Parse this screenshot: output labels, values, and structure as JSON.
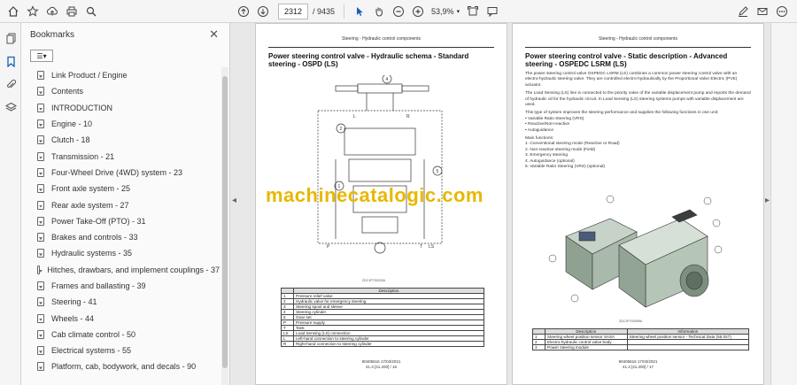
{
  "toolbar": {
    "page_current": "2312",
    "page_total": "/ 9435",
    "zoom": "53,9%",
    "icons": [
      "home-icon",
      "star-icon",
      "upload-icon",
      "print-icon",
      "zoom-search-icon",
      "arrow-up-icon",
      "arrow-down-icon",
      "select-cursor-icon",
      "hand-icon",
      "zoom-out-icon",
      "zoom-in-icon",
      "fit-page-icon",
      "comment-icon",
      "sign-pen-icon",
      "mail-icon",
      "more-icon"
    ]
  },
  "panel": {
    "title": "Bookmarks",
    "bookmarks": [
      "Link Product / Engine",
      "Contents",
      "INTRODUCTION",
      "Engine - 10",
      "Clutch - 18",
      "Transmission - 21",
      "Four-Wheel Drive (4WD) system - 23",
      "Front axle system - 25",
      "Rear axle system - 27",
      "Power Take-Off (PTO) - 31",
      "Brakes and controls - 33",
      "Hydraulic systems - 35",
      "Hitches, drawbars, and implement couplings - 37",
      "Frames and ballasting - 39",
      "Steering - 41",
      "Wheels - 44",
      "Cab climate control - 50",
      "Electrical systems - 55",
      "Platform, cab, bodywork, and decals - 90"
    ]
  },
  "left_page": {
    "header": "Steering - Hydraulic control components",
    "title": "Power steering control valve - Hydraulic schema - Standard steering - OSPD (LS)",
    "figure_id": "ZDC1PTS0033A",
    "table_headers": [
      "",
      "Description"
    ],
    "table_rows": [
      [
        "1",
        "Pressure relief valve"
      ],
      [
        "2",
        "Hydraulic valve for emergency steering"
      ],
      [
        "3",
        "Steering spool and sleeve"
      ],
      [
        "4",
        "Steering cylinder"
      ],
      [
        "5",
        "Gear set"
      ],
      [
        "P",
        "Pressure supply"
      ],
      [
        "T",
        "Tank"
      ],
      [
        "LS",
        "Load Sensing (LS) connection"
      ],
      [
        "L",
        "Left-hand connection to steering cylinder"
      ],
      [
        "R",
        "Right-hand connection to steering cylinder"
      ]
    ],
    "footer_1": "90405616 17/03/2021",
    "footer_2": "41.3 [41.200] / 16"
  },
  "right_page": {
    "header": "Steering - Hydraulic control components",
    "title": "Power steering control valve - Static description - Advanced steering - OSPEDC LSRM (LS)",
    "para_1": "The power steering control valve OSPEDC LSRM (LS) combines a common power steering control valve with an electro-hydraulic steering valve. They are controlled electro-hydraulically by the Proportional Valve Electric (PVE) actuator.",
    "para_2": "The Load Sensing (LS) line is connected to the priority valve of the variable displacement pump and reports the demand of hydraulic oil for the hydraulic circuit. In Load Sensing (LS) steering systems pumps with variable displacement are used.",
    "para_3": "This type of system improves the steering performance and supplies the following functions in one unit:",
    "bullets": [
      "Variable Ratio Steering (VRS)",
      "Reactive/Non-reactive",
      "Autoguidance"
    ],
    "main_functions_label": "Main functions:",
    "functions": [
      "1.  Conventional steering mode (Reactive or Road)",
      "2.  Non-reactive steering mode (Field)",
      "3.  Emergency steering",
      "4.  Autoguidance (optional)",
      "5.  Variable Ratio Steering (VRS) (optional)"
    ],
    "figure_id": "ZDC1PTS0059A",
    "table_headers": [
      "",
      "Description",
      "Information"
    ],
    "table_rows": [
      [
        "1",
        "Steering wheel position sensor SASA",
        "Steering wheel position sensor - Technical Data (55.047)"
      ],
      [
        "2",
        "Electro-hydraulic control valve body",
        ""
      ],
      [
        "3",
        "Power steering module",
        ""
      ]
    ],
    "footer_1": "90405616 17/03/2021",
    "footer_2": "41.3 [41.200] / 17"
  },
  "watermark": "machinecatalogic.com"
}
